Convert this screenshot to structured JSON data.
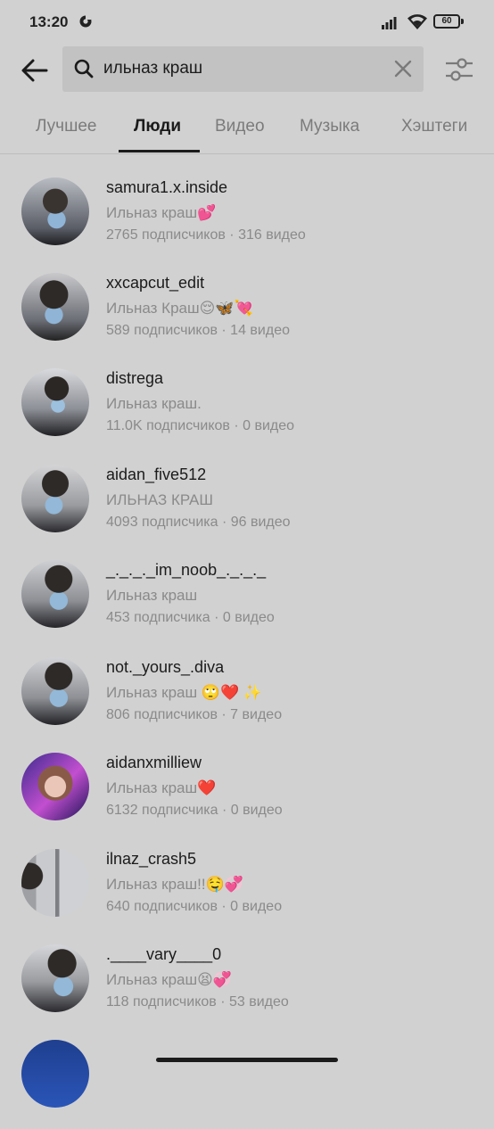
{
  "status_bar": {
    "time": "13:20",
    "battery": "60"
  },
  "search": {
    "query": "ильназ краш"
  },
  "tabs": [
    {
      "label": "Лучшее",
      "active": false
    },
    {
      "label": "Люди",
      "active": true
    },
    {
      "label": "Видео",
      "active": false
    },
    {
      "label": "Музыка",
      "active": false
    },
    {
      "label": "Хэштеги",
      "active": false
    }
  ],
  "results": [
    {
      "username": "samura1.x.inside",
      "nickname": "Ильназ краш💕",
      "stats": "2765 подписчиков · 316 видео"
    },
    {
      "username": "xxcapcut_edit",
      "nickname": "Ильназ Краш😌🦋💘",
      "stats": "589 подписчиков · 14 видео"
    },
    {
      "username": "distrega",
      "nickname": "Ильназ краш.",
      "stats": "11.0K подписчиков · 0 видео"
    },
    {
      "username": "aidan_five512",
      "nickname": "ИЛЬНАЗ КРАШ",
      "stats": "4093 подписчика · 96 видео"
    },
    {
      "username": "_._._._im_noob_._._._",
      "nickname": "Ильназ краш",
      "stats": "453 подписчика · 0 видео"
    },
    {
      "username": "not._yours_.diva",
      "nickname": "Ильназ краш 🙄❤️ ✨",
      "stats": "806 подписчиков · 7 видео"
    },
    {
      "username": "aidanxmilliew",
      "nickname": "Ильназ краш❤️",
      "stats": "6132 подписчика · 0 видео"
    },
    {
      "username": "ilnaz_crash5",
      "nickname": "Ильназ краш!!🤤💞",
      "stats": "640 подписчиков · 0 видео"
    },
    {
      "username": ".____vary____0",
      "nickname": "Ильназ краш😫💞",
      "stats": "118 подписчиков · 53 видео"
    }
  ]
}
